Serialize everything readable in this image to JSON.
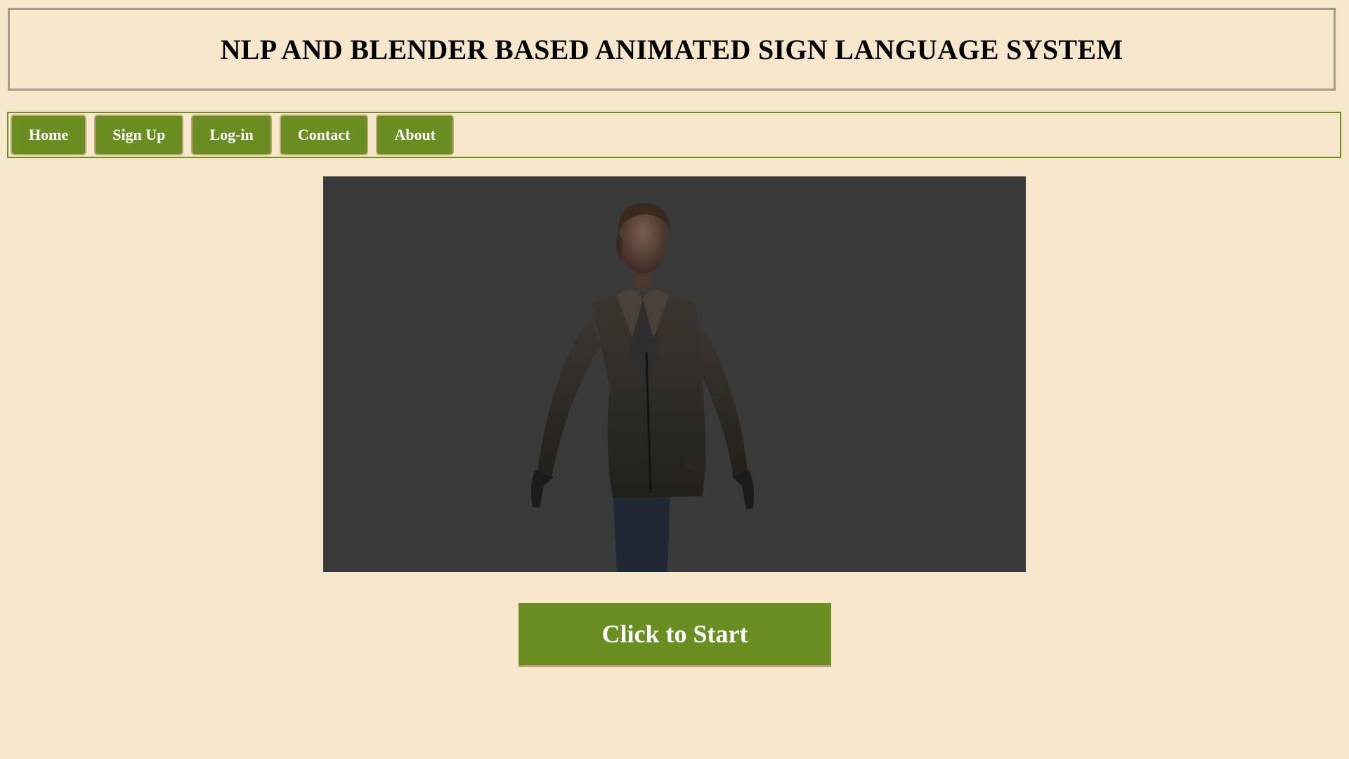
{
  "header": {
    "title": "NLP AND BLENDER BASED ANIMATED SIGN LANGUAGE SYSTEM"
  },
  "nav": {
    "items": [
      {
        "label": "Home"
      },
      {
        "label": "Sign Up"
      },
      {
        "label": "Log-in"
      },
      {
        "label": "Contact"
      },
      {
        "label": "About"
      }
    ]
  },
  "main": {
    "avatar_icon": "3d-avatar-figure",
    "start_label": "Click to Start"
  },
  "colors": {
    "background": "#f6e6cc",
    "accent": "#6b8e23",
    "viewport": "#3a3a3a"
  }
}
